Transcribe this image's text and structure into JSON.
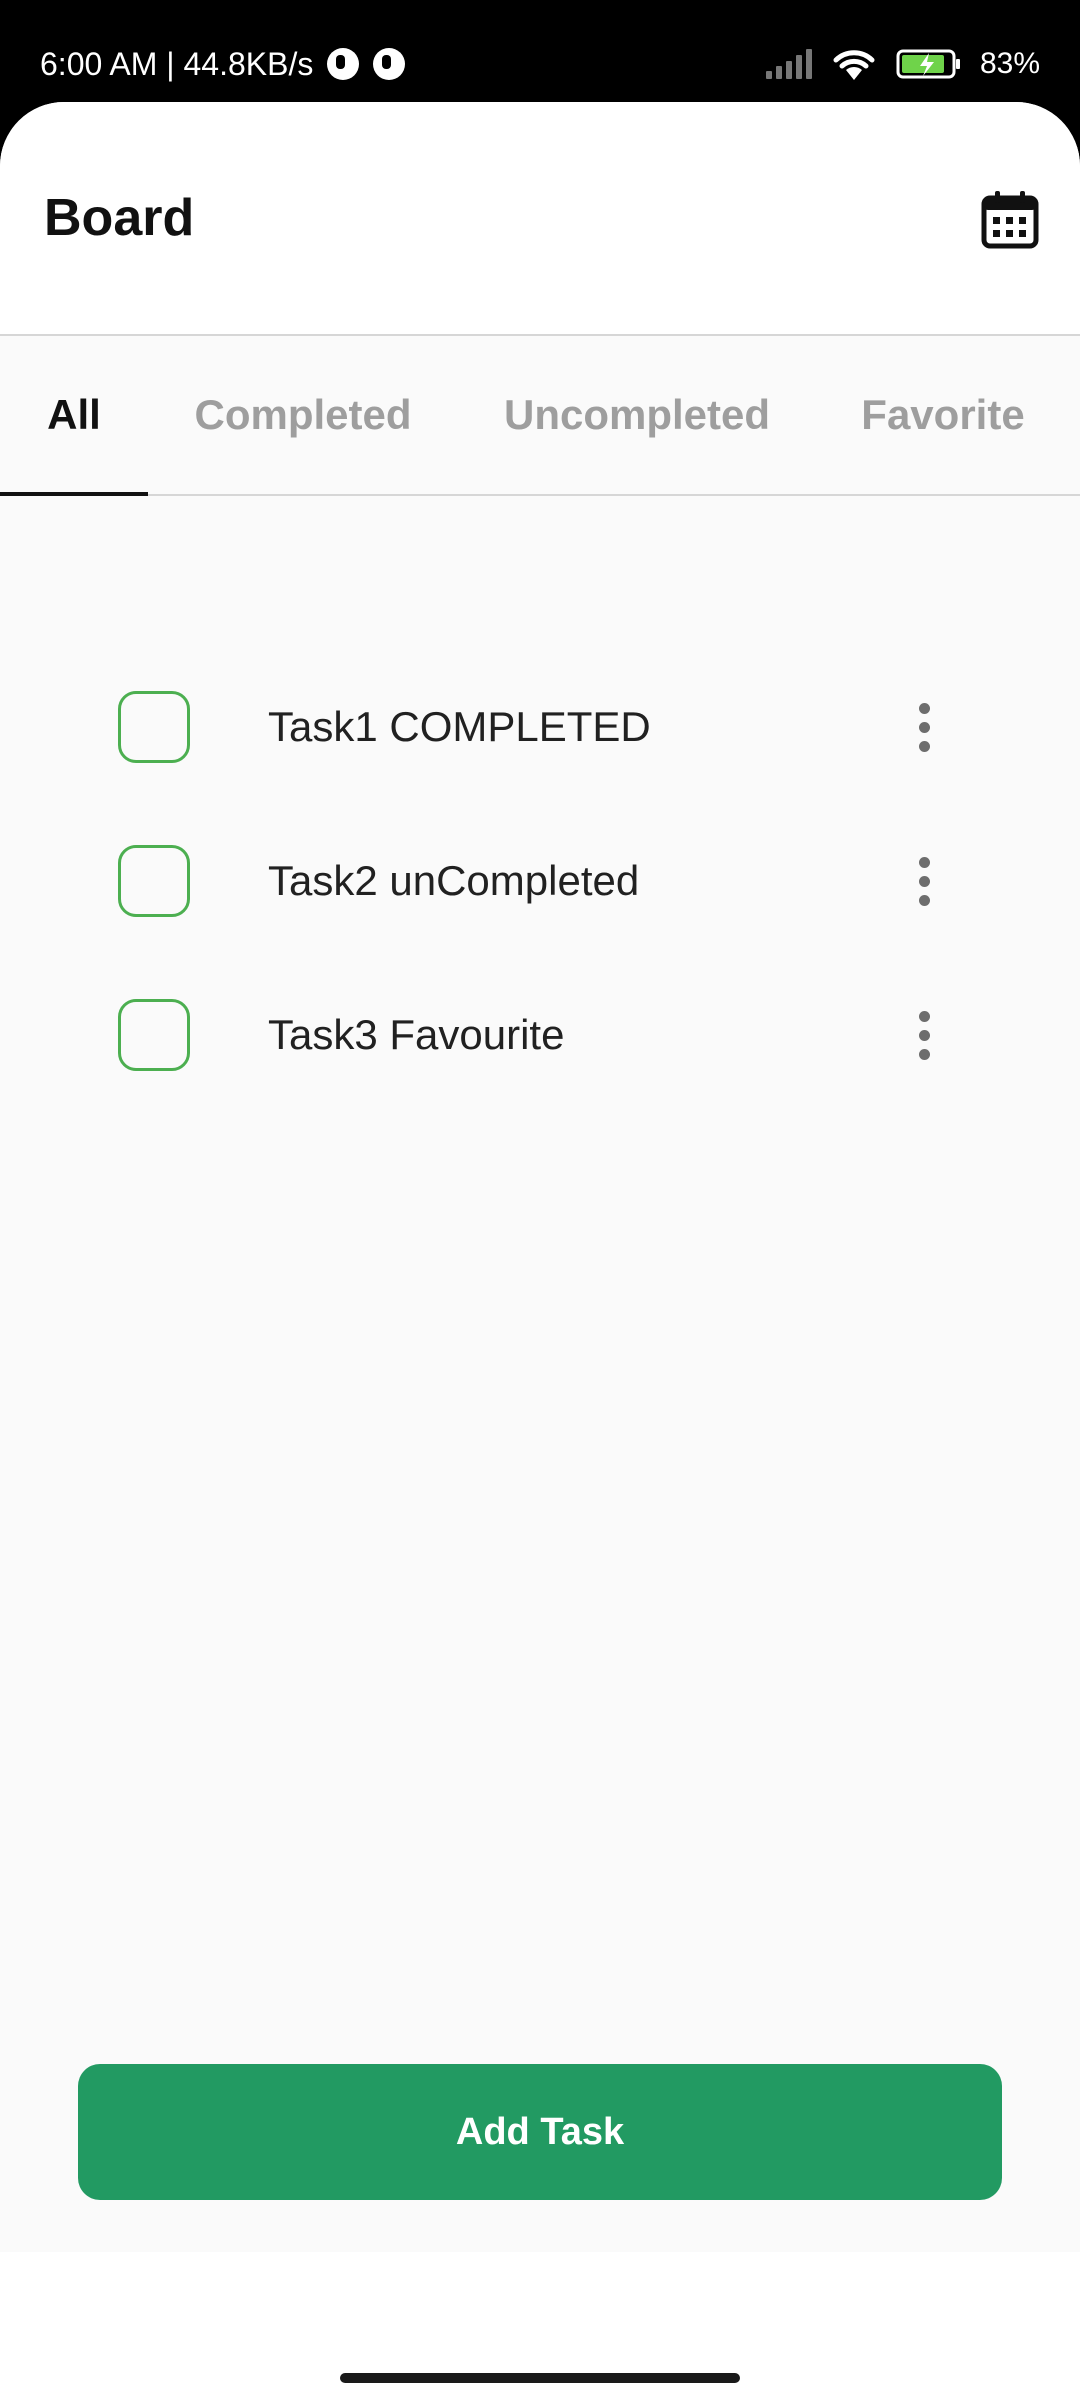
{
  "status_bar": {
    "time_speed": "6:00 AM | 44.8KB/s",
    "battery": "83%",
    "icons": [
      "notification-icon",
      "notification-icon",
      "signal-icon",
      "wifi-icon",
      "battery-charging-icon"
    ]
  },
  "header": {
    "title": "Board",
    "calendar_icon": "calendar-icon"
  },
  "tabs": [
    {
      "label": "All",
      "active": true
    },
    {
      "label": "Completed",
      "active": false
    },
    {
      "label": "Uncompleted",
      "active": false
    },
    {
      "label": "Favorite",
      "active": false
    }
  ],
  "tasks": [
    {
      "label": "Task1 COMPLETED",
      "checked": false
    },
    {
      "label": "Task2 unCompleted",
      "checked": false
    },
    {
      "label": "Task3 Favourite",
      "checked": false
    }
  ],
  "actions": {
    "add_task_label": "Add Task"
  },
  "colors": {
    "accent_green": "#229a62",
    "checkbox_border": "#4caf50",
    "inactive_tab": "#9e9e9e"
  }
}
